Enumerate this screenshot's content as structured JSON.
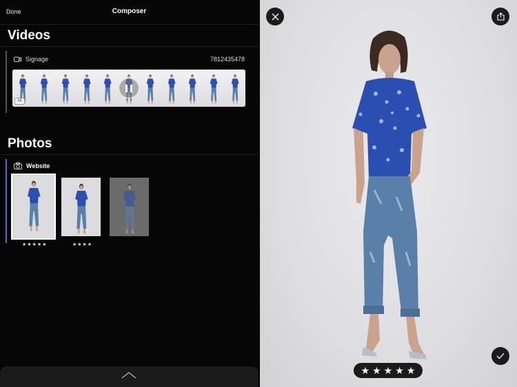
{
  "header": {
    "done_label": "Done",
    "title": "Composer"
  },
  "videos": {
    "section_title": "Videos",
    "group": {
      "name": "Signage",
      "count": "7812435478",
      "badge": "4K"
    },
    "frames": 11
  },
  "photos": {
    "section_title": "Photos",
    "group": {
      "name": "Website"
    },
    "items": [
      {
        "rating": "★★★★★",
        "selected": true
      },
      {
        "rating": "★★★★",
        "selected": false
      },
      {
        "rating": "",
        "selected": false
      }
    ]
  },
  "viewer": {
    "rating": 5
  },
  "colors": {
    "accent_bar": "#5b6bd6",
    "shirt": "#2a4fb0",
    "jeans": "#5a7fa8"
  }
}
